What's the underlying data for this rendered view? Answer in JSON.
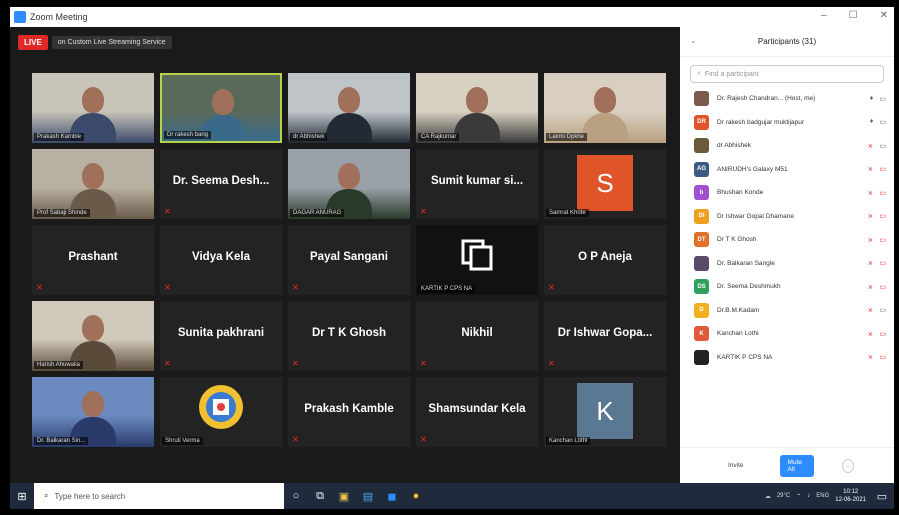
{
  "window": {
    "title": "Zoom Meeting",
    "controls": [
      "–",
      "☐",
      "✕"
    ]
  },
  "live": {
    "badge": "LIVE",
    "label": "on Custom Live Streaming Service"
  },
  "tiles": [
    {
      "row": 0,
      "col": 0,
      "kind": "video",
      "name": "Prakash Kamble"
    },
    {
      "row": 0,
      "col": 1,
      "kind": "video",
      "name": "Dr rakesh bang",
      "active": true
    },
    {
      "row": 0,
      "col": 2,
      "kind": "video",
      "name": "dr Abhishek"
    },
    {
      "row": 0,
      "col": 3,
      "kind": "video",
      "name": "CA Rajkumar"
    },
    {
      "row": 0,
      "col": 4,
      "kind": "video",
      "name": "Laxmi Dpkhe"
    },
    {
      "row": 1,
      "col": 0,
      "kind": "video",
      "name": "Prof Sabaji Shinde"
    },
    {
      "row": 1,
      "col": 1,
      "kind": "name",
      "name": "Dr. Seema Desh..."
    },
    {
      "row": 1,
      "col": 2,
      "kind": "video",
      "name": "DAGAR ANURAG"
    },
    {
      "row": 1,
      "col": 3,
      "kind": "name",
      "name": "Sumit kumar si..."
    },
    {
      "row": 1,
      "col": 4,
      "kind": "avatar",
      "letter": "S",
      "color": "#e0542a",
      "name": "Samrat Khote"
    },
    {
      "row": 2,
      "col": 0,
      "kind": "name",
      "name": "Prashant"
    },
    {
      "row": 2,
      "col": 1,
      "kind": "name",
      "name": "Vidya Kela"
    },
    {
      "row": 2,
      "col": 2,
      "kind": "name",
      "name": "Payal Sangani"
    },
    {
      "row": 2,
      "col": 3,
      "kind": "logo",
      "name": "KARTIK P CPS NA"
    },
    {
      "row": 2,
      "col": 4,
      "kind": "name",
      "name": "O P Aneja"
    },
    {
      "row": 3,
      "col": 0,
      "kind": "video",
      "name": "Harish Ahuwalia"
    },
    {
      "row": 3,
      "col": 1,
      "kind": "name",
      "name": "Sunita pakhrani"
    },
    {
      "row": 3,
      "col": 2,
      "kind": "name",
      "name": "Dr T K Ghosh"
    },
    {
      "row": 3,
      "col": 3,
      "kind": "name",
      "name": "Nikhil"
    },
    {
      "row": 3,
      "col": 4,
      "kind": "name",
      "name": "Dr Ishwar Gopa..."
    },
    {
      "row": 4,
      "col": 0,
      "kind": "video",
      "name": "Dr. Balkaran Sin..."
    },
    {
      "row": 4,
      "col": 1,
      "kind": "emblem",
      "name": "Shruti Verma"
    },
    {
      "row": 4,
      "col": 2,
      "kind": "name",
      "name": "Prakash Kamble"
    },
    {
      "row": 4,
      "col": 3,
      "kind": "name",
      "name": "Shamsundar Kela"
    },
    {
      "row": 4,
      "col": 4,
      "kind": "avatar",
      "letter": "K",
      "color": "#5b7893",
      "name": "Kanchan Lothi"
    }
  ],
  "participants": {
    "title": "Participants (31)",
    "search_placeholder": "Find a participant",
    "list": [
      {
        "name": "Dr. Rajesh Chandran... (Host, me)",
        "av": "photo",
        "color": "#7a5a4a",
        "mic": "on",
        "cam": "on"
      },
      {
        "name": "Dr rakesh badgujar muktijapur",
        "av": "DR",
        "color": "#e0542a",
        "mic": "on",
        "cam": "on"
      },
      {
        "name": "dr Abhishek",
        "av": "photo",
        "color": "#6a5a3a",
        "mic": "muted",
        "cam": "on"
      },
      {
        "name": "ANIRUDH's Galaxy M51",
        "av": "AG",
        "color": "#3d5a80",
        "mic": "muted",
        "cam": "muted"
      },
      {
        "name": "Bhushan Konde",
        "av": "b",
        "color": "#a050d0",
        "mic": "muted",
        "cam": "muted"
      },
      {
        "name": "Dr Ishwar Gopal Dhamane",
        "av": "DI",
        "color": "#f0a020",
        "mic": "muted",
        "cam": "muted"
      },
      {
        "name": "Dr T K Ghosh",
        "av": "DT",
        "color": "#e0702a",
        "mic": "muted",
        "cam": "muted"
      },
      {
        "name": "Dr. Balkaran Sangle",
        "av": "photo",
        "color": "#5a4a6a",
        "mic": "muted",
        "cam": "muted"
      },
      {
        "name": "Dr. Seema Deshmukh",
        "av": "DS",
        "color": "#30a060",
        "mic": "muted",
        "cam": "muted"
      },
      {
        "name": "Dr.B.M.Kadam",
        "av": "D",
        "color": "#f0b020",
        "mic": "muted",
        "cam": "on"
      },
      {
        "name": "Kanchan Lothi",
        "av": "K",
        "color": "#e05a3a",
        "mic": "muted",
        "cam": "muted"
      },
      {
        "name": "KARTIK P CPS NA",
        "av": "logo",
        "color": "#222222",
        "mic": "muted",
        "cam": "muted"
      }
    ],
    "invite_label": "Invite",
    "mute_all_label": "Mute All",
    "more_label": "..."
  },
  "taskbar": {
    "search_placeholder": "Type here to search",
    "weather": "29°C",
    "lang": "ENG",
    "time": "10:12",
    "date": "12-06-2021"
  }
}
